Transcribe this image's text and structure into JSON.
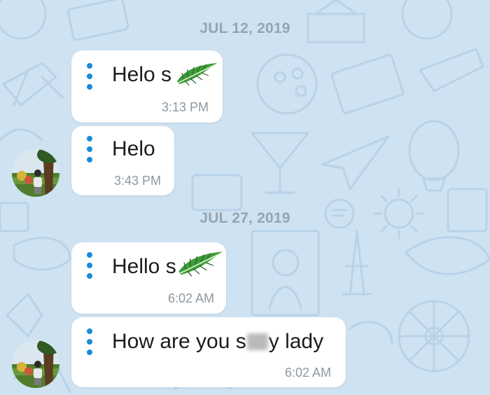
{
  "chat": {
    "date_separators": [
      "JUL 12, 2019",
      "JUL 27, 2019"
    ],
    "messages": [
      {
        "text": "Helo s",
        "time": "3:13 PM",
        "sticker": "palm-leaf-sticker"
      },
      {
        "text": "Helo",
        "time": "3:43 PM"
      },
      {
        "text": "Hello s",
        "time": "6:02 AM",
        "sticker": "palm-leaf-sticker"
      },
      {
        "text_before": "How are you s",
        "text_after": "y lady",
        "time": "6:02 AM",
        "redaction": "blurred-word-part"
      }
    ]
  },
  "icons": {
    "message_menu": "vertical-dots-icon",
    "avatar": "user-avatar-photo"
  },
  "colors": {
    "background": "#cfe2f1",
    "bubble": "#ffffff",
    "accent_dots": "#1a8ad8",
    "date_text": "#94a5b2",
    "time_text": "#8c98a2",
    "message_text": "#1c1c1c"
  }
}
